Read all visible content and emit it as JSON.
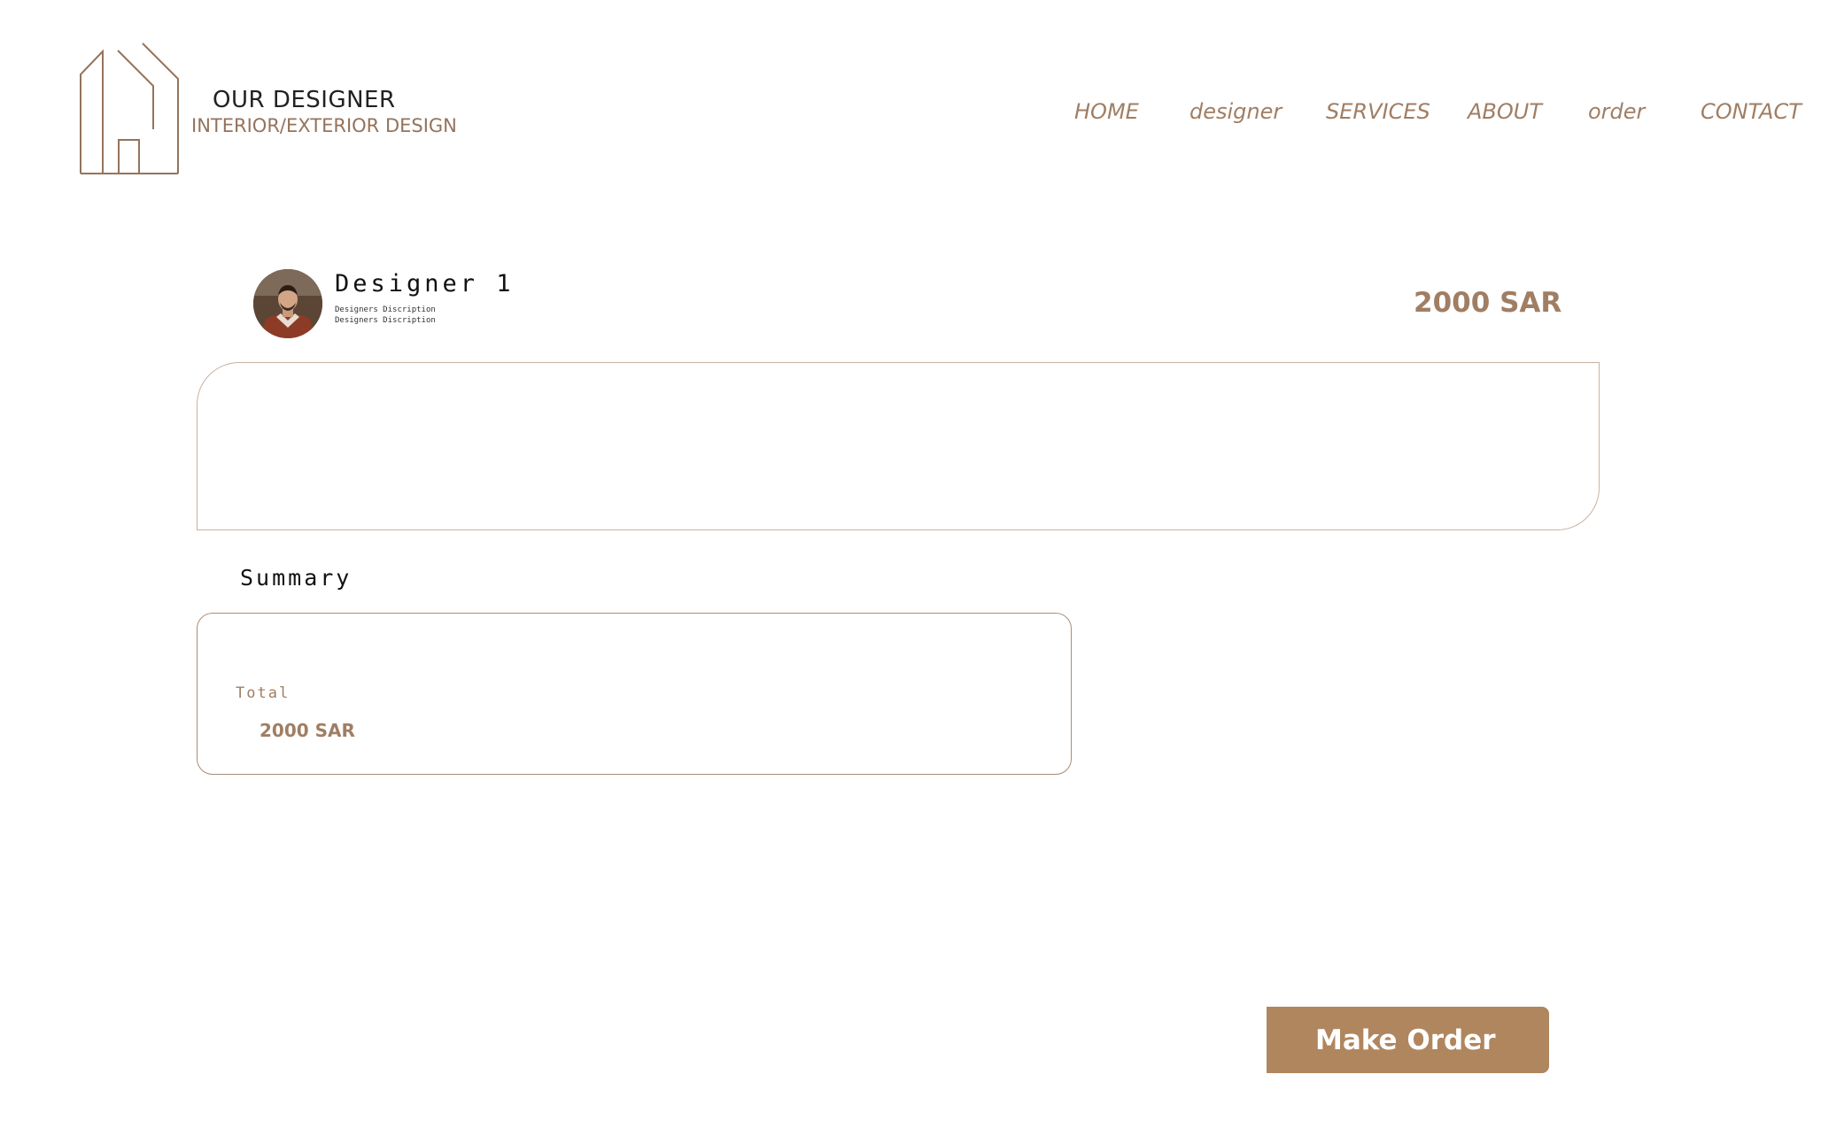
{
  "brand": {
    "title": "OUR DESIGNER",
    "subtitle": "INTERIOR/EXTERIOR DESIGN",
    "logo_icon": "house-outline-icon"
  },
  "nav": {
    "items": [
      {
        "label": "HOME"
      },
      {
        "label": "designer"
      },
      {
        "label": "SERVICES"
      },
      {
        "label": "ABOUT"
      },
      {
        "label": "order"
      },
      {
        "label": "CONTACT"
      }
    ]
  },
  "designer": {
    "name": "Designer 1",
    "description_line_1": "Designers Discription",
    "description_line_2": "Designers Discription",
    "price": "2000 SAR"
  },
  "summary": {
    "title": "Summary",
    "total_label": "Total",
    "total_value": "2000 SAR"
  },
  "actions": {
    "order_label": "Make Order"
  },
  "colors": {
    "accent": "#b0865e",
    "accent_text": "#a07e63",
    "border": "#c9b2a2",
    "logo_stroke": "#94735b"
  }
}
